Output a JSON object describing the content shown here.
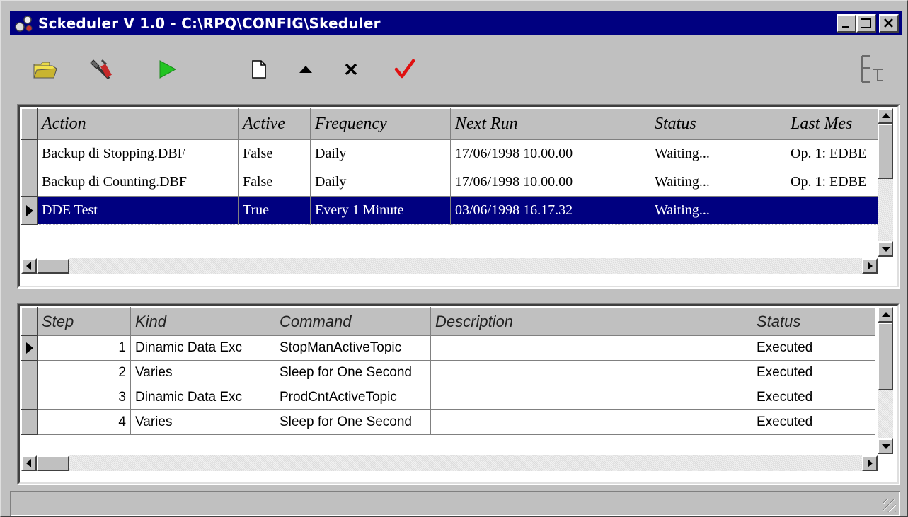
{
  "window": {
    "title": "Sckeduler V 1.0 - C:\\RPQ\\CONFIG\\Skeduler",
    "app_icon": "scheduler-app-icon",
    "caption_buttons": [
      "minimize-icon",
      "maximize-icon",
      "close-icon"
    ]
  },
  "toolbar": {
    "items": [
      {
        "name": "open-folder-icon"
      },
      {
        "name": "tools-icon"
      },
      {
        "name": "run-play-icon",
        "color": "#22c422"
      },
      {
        "name": "new-document-icon"
      },
      {
        "name": "move-up-icon"
      },
      {
        "name": "delete-icon"
      },
      {
        "name": "confirm-check-icon",
        "color": "#e01010"
      },
      {
        "name": "layout-tree-icon"
      }
    ]
  },
  "actions_grid": {
    "columns": [
      "Action",
      "Active",
      "Frequency",
      "Next Run",
      "Status",
      "Last Mes"
    ],
    "rows": [
      {
        "action": "Backup di Stopping.DBF",
        "active": "False",
        "frequency": "Daily",
        "next_run": "17/06/1998 10.00.00",
        "status": "Waiting...",
        "last_message": "Op. 1: EDBE"
      },
      {
        "action": "Backup di Counting.DBF",
        "active": "False",
        "frequency": "Daily",
        "next_run": "17/06/1998 10.00.00",
        "status": "Waiting...",
        "last_message": "Op. 1: EDBE"
      },
      {
        "action": "DDE Test",
        "active": "True",
        "frequency": "Every 1 Minute",
        "next_run": "03/06/1998 16.17.32",
        "status": "Waiting...",
        "last_message": ""
      }
    ],
    "selected_row": 2
  },
  "steps_grid": {
    "columns": [
      "Step",
      "Kind",
      "Command",
      "Description",
      "Status"
    ],
    "rows": [
      {
        "step": "1",
        "kind": "Dinamic Data Exc",
        "command": "StopManActiveTopic",
        "description": "",
        "status": "Executed"
      },
      {
        "step": "2",
        "kind": "Varies",
        "command": "Sleep for One Second",
        "description": "",
        "status": "Executed"
      },
      {
        "step": "3",
        "kind": "Dinamic Data Exc",
        "command": "ProdCntActiveTopic",
        "description": "",
        "status": "Executed"
      },
      {
        "step": "4",
        "kind": "Varies",
        "command": "Sleep for One Second",
        "description": "",
        "status": "Executed"
      }
    ],
    "selected_row": 0
  },
  "colors": {
    "titlebar": "#000080",
    "selection": "#000080",
    "face": "#c0c0c0"
  }
}
